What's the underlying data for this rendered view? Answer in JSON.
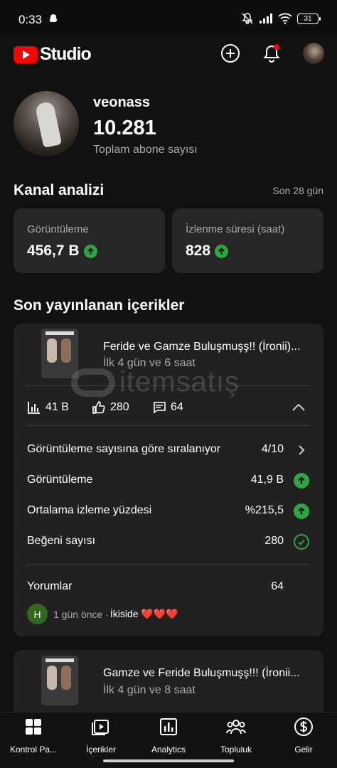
{
  "status_bar": {
    "time": "0:33",
    "battery": "31"
  },
  "header": {
    "logo_text": "Studio"
  },
  "profile": {
    "channel_name": "veonass",
    "subscriber_count": "10.281",
    "subscriber_label": "Toplam abone sayısı"
  },
  "analytics": {
    "title": "Kanal analizi",
    "period": "Son 28 gün",
    "cards": [
      {
        "label": "Görüntüleme",
        "value": "456,7 B",
        "trend": "up"
      },
      {
        "label": "İzlenme süresi (saat)",
        "value": "828",
        "trend": "up"
      }
    ]
  },
  "recent": {
    "title": "Son yayınlanan içerikler",
    "videos": [
      {
        "title": "Feride ve Gamze Buluşmuşş!! (İronii)...",
        "age": "İlk 4 gün ve 6 saat",
        "views": "41 B",
        "likes": "280",
        "comments": "64",
        "ranking_label": "Görüntüleme sayısına göre sıralanıyor",
        "ranking_value": "4/10",
        "rows": [
          {
            "label": "Görüntüleme",
            "value": "41,9 B",
            "status": "up"
          },
          {
            "label": "Ortalama izleme yüzdesi",
            "value": "%215,5",
            "status": "up"
          },
          {
            "label": "Beğeni sayısı",
            "value": "280",
            "status": "check"
          }
        ],
        "comments_label": "Yorumlar",
        "comments_count": "64",
        "latest_comment": {
          "avatar_letter": "H",
          "time": "1 gün önce · ",
          "text": "İkiside ❤️❤️❤️"
        }
      },
      {
        "title": "Gamze ve Feride Buluşmuşş!!! (İronii...",
        "age": "İlk 4 gün ve 8 saat"
      }
    ]
  },
  "watermark": {
    "text": "itemsatış"
  },
  "bottom_nav": [
    {
      "label": "Kontrol Pa...",
      "icon": "dashboard-icon"
    },
    {
      "label": "İçerikler",
      "icon": "content-icon"
    },
    {
      "label": "Analytics",
      "icon": "analytics-icon"
    },
    {
      "label": "Topluluk",
      "icon": "community-icon"
    },
    {
      "label": "Gelir",
      "icon": "earn-icon"
    }
  ],
  "colors": {
    "background": "#111111",
    "card": "#262626",
    "accent_red": "#ff0000",
    "trend_green": "#2ba640"
  }
}
